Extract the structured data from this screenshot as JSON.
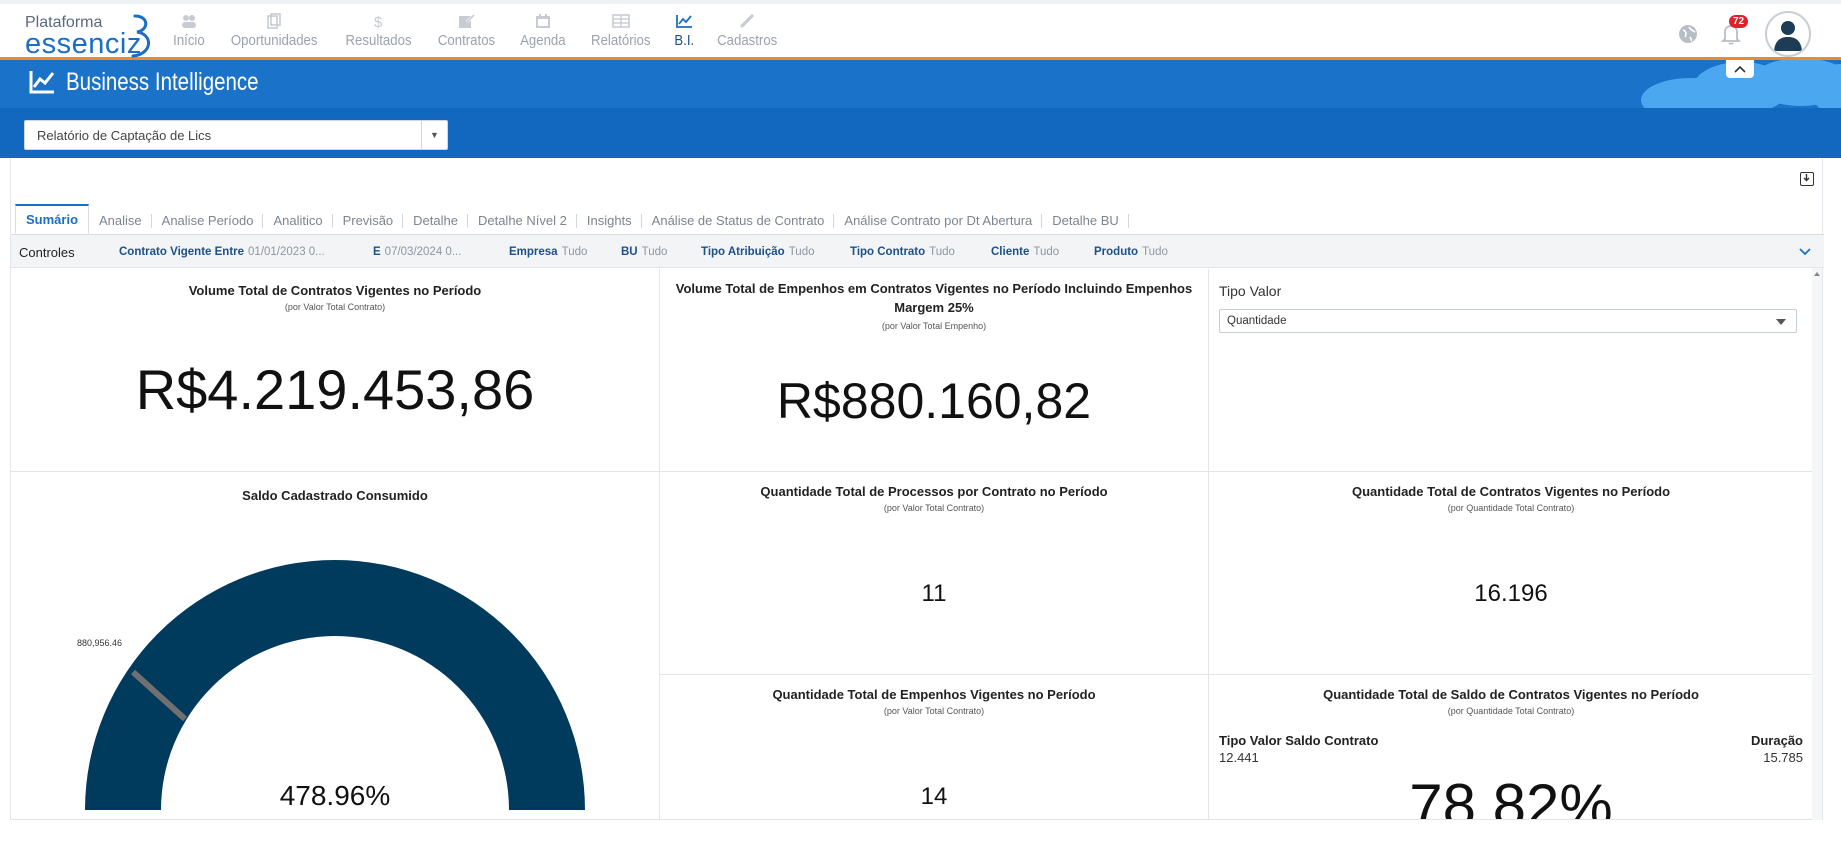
{
  "brand": {
    "line1": "Plataforma",
    "line2": "essenciz"
  },
  "nav": {
    "items": [
      {
        "label": "Início",
        "icon": "users-icon",
        "active": false
      },
      {
        "label": "Oportunidades",
        "icon": "copy-icon",
        "active": false
      },
      {
        "label": "Resultados",
        "icon": "dollar-icon",
        "active": false
      },
      {
        "label": "Contratos",
        "icon": "edit-icon",
        "active": false
      },
      {
        "label": "Agenda",
        "icon": "calendar-icon",
        "active": false
      },
      {
        "label": "Relatórios",
        "icon": "table-icon",
        "active": false
      },
      {
        "label": "B.I.",
        "icon": "line-chart-icon",
        "active": true
      },
      {
        "label": "Cadastros",
        "icon": "pencil-icon",
        "active": false
      }
    ],
    "notifications_count": "72"
  },
  "header": {
    "title": "Business Intelligence"
  },
  "report_select": {
    "value": "Relatório de Captação de Lics"
  },
  "tabs": [
    {
      "label": "Sumário",
      "active": true
    },
    {
      "label": "Analise"
    },
    {
      "label": "Analise Período"
    },
    {
      "label": "Analitico"
    },
    {
      "label": "Previsão"
    },
    {
      "label": "Detalhe"
    },
    {
      "label": "Detalhe Nível 2"
    },
    {
      "label": "Insights"
    },
    {
      "label": "Análise de Status de Contrato"
    },
    {
      "label": "Análise Contrato por Dt Abertura"
    },
    {
      "label": "Detalhe BU"
    }
  ],
  "controls": {
    "title": "Controles",
    "filters": [
      {
        "key": "Contrato Vigente Entre",
        "value": "01/01/2023 0..."
      },
      {
        "key": "E",
        "value": "07/03/2024 0..."
      },
      {
        "key": "Empresa",
        "value": "Tudo"
      },
      {
        "key": "BU",
        "value": "Tudo"
      },
      {
        "key": "Tipo Atribuição",
        "value": "Tudo"
      },
      {
        "key": "Tipo Contrato",
        "value": "Tudo"
      },
      {
        "key": "Cliente",
        "value": "Tudo"
      },
      {
        "key": "Produto",
        "value": "Tudo"
      }
    ]
  },
  "tiles": {
    "volume_contratos": {
      "title": "Volume Total de Contratos Vigentes no Período",
      "subtitle": "(por Valor Total Contrato)",
      "value": "R$4.219.453,86"
    },
    "volume_empenhos": {
      "title": "Volume Total de Empenhos em Contratos Vigentes no Período Incluindo Empenhos Margem 25%",
      "subtitle": "(por Valor Total Empenho)",
      "value": "R$880.160,82"
    },
    "tipo_valor": {
      "label": "Tipo Valor",
      "selected": "Quantidade"
    },
    "saldo_consumido": {
      "title": "Saldo Cadastrado Consumido",
      "marker_label": "880,956.46",
      "percent": "478.96%"
    },
    "qtd_processos": {
      "title": "Quantidade Total de Processos por Contrato no Período",
      "subtitle": "(por Valor Total Contrato)",
      "value": "11"
    },
    "qtd_contratos": {
      "title": "Quantidade Total de Contratos Vigentes no Período",
      "subtitle": "(por Quantidade Total Contrato)",
      "value": "16.196"
    },
    "qtd_empenhos": {
      "title": "Quantidade Total de Empenhos Vigentes no Período",
      "subtitle": "(por Valor Total Contrato)",
      "value": "14"
    },
    "qtd_saldo": {
      "title": "Quantidade Total de Saldo de Contratos Vigentes no Período",
      "subtitle": "(por Quantidade Total Contrato)",
      "left_label": "Tipo Valor Saldo Contrato",
      "left_value": "12.441",
      "right_label": "Duração",
      "right_value": "15.785",
      "percent": "78.82%"
    }
  },
  "colors": {
    "brand_blue": "#1a73c9",
    "accent_orange": "#f0892a",
    "gauge_navy": "#003a5d",
    "badge_red": "#e2202a"
  }
}
